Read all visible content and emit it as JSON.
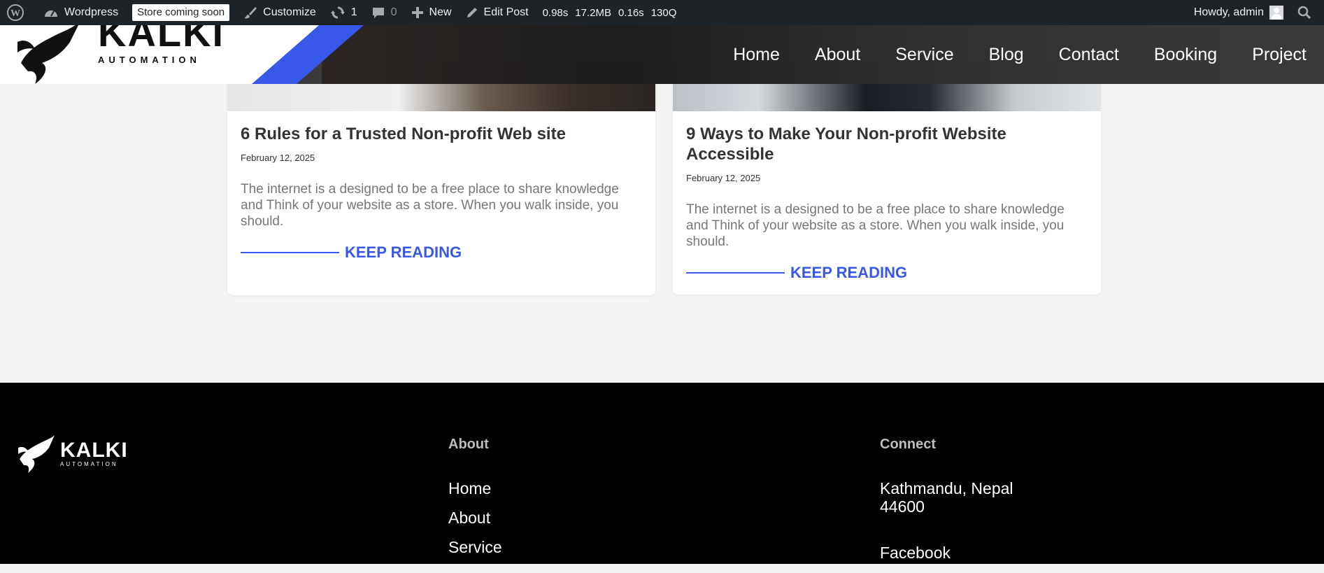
{
  "adminbar": {
    "site_name": "Wordpress",
    "store_badge": "Store coming soon",
    "customize": "Customize",
    "updates_count": "1",
    "comments_count": "0",
    "new_label": "New",
    "edit_post": "Edit Post",
    "stats": [
      "0.98s",
      "17.2MB",
      "0.16s",
      "130Q"
    ],
    "howdy": "Howdy, admin"
  },
  "header": {
    "logo_text": "KALKI",
    "logo_subtext": "AUTOMATION",
    "nav": [
      "Home",
      "About",
      "Service",
      "Blog",
      "Contact",
      "Booking",
      "Project"
    ]
  },
  "posts": [
    {
      "title": "6 Rules for a Trusted Non-profit Web site",
      "date": "February 12, 2025",
      "excerpt": "The internet is a designed to be a free place to share knowledge and Think of your website as a store. When you walk inside, you should.",
      "link": "KEEP READING"
    },
    {
      "title": "9 Ways to Make Your Non-profit Website Accessible",
      "date": "February 12, 2025",
      "excerpt": "The internet is a designed to be a free place to share knowledge and Think of your website as a store. When you walk inside, you should.",
      "link": "KEEP READING"
    }
  ],
  "footer": {
    "logo_text": "KALKI",
    "logo_subtext": "AUTOMATION",
    "about": {
      "heading": "About",
      "links": [
        "Home",
        "About",
        "Service"
      ]
    },
    "connect": {
      "heading": "Connect",
      "address": "Kathmandu, Nepal 44600",
      "links": [
        "Facebook"
      ]
    }
  },
  "colors": {
    "accent": "#3858e9",
    "admin_bar": "#1d2327",
    "footer_bg": "#000000"
  }
}
